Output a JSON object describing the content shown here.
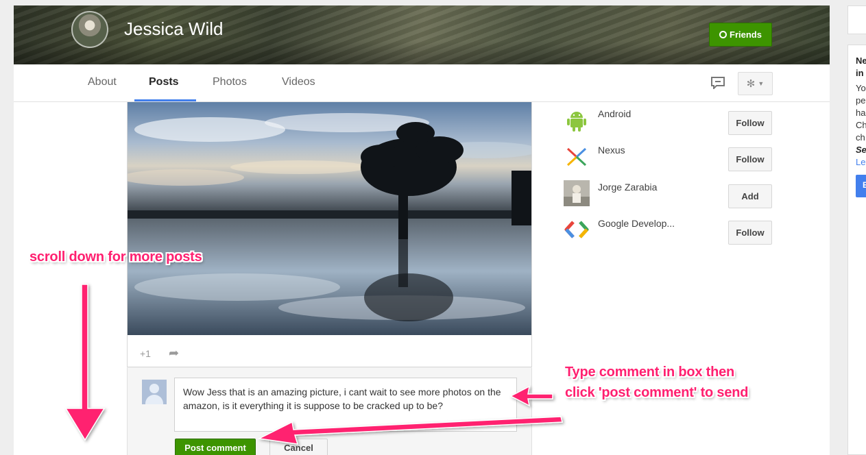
{
  "profile": {
    "name": "Jessica Wild",
    "friends_label": "Friends"
  },
  "tabs": [
    "About",
    "Posts",
    "Photos",
    "Videos"
  ],
  "active_tab": "Posts",
  "post": {
    "plus_one": "+1"
  },
  "comment": {
    "text": "Wow Jess that is an amazing picture, i cant wait to see more photos on the amazon, is it everything it is suppose to be cracked up to be?",
    "post_label": "Post comment",
    "cancel_label": "Cancel"
  },
  "recommendations": [
    {
      "name": "Android",
      "action": "Follow",
      "icon": "android-icon"
    },
    {
      "name": "Nexus",
      "action": "Follow",
      "icon": "nexus-icon"
    },
    {
      "name": "Jorge Zarabia",
      "action": "Add",
      "icon": "person-photo"
    },
    {
      "name": "Google Develop...",
      "action": "Follow",
      "icon": "google-developers-icon"
    }
  ],
  "side_card": {
    "lines": [
      "Ne",
      "in",
      "Yo",
      "pe",
      "ha",
      "Ch",
      "ch",
      "Se",
      "Le"
    ],
    "button": "E"
  },
  "annotations": {
    "scroll": "scroll down for more posts",
    "type_line1": "Type comment in box then",
    "type_line2": "click 'post comment' to send"
  },
  "colors": {
    "accent_green": "#3d9400",
    "tab_underline": "#427fed",
    "annotation_pink": "#ff2070"
  }
}
